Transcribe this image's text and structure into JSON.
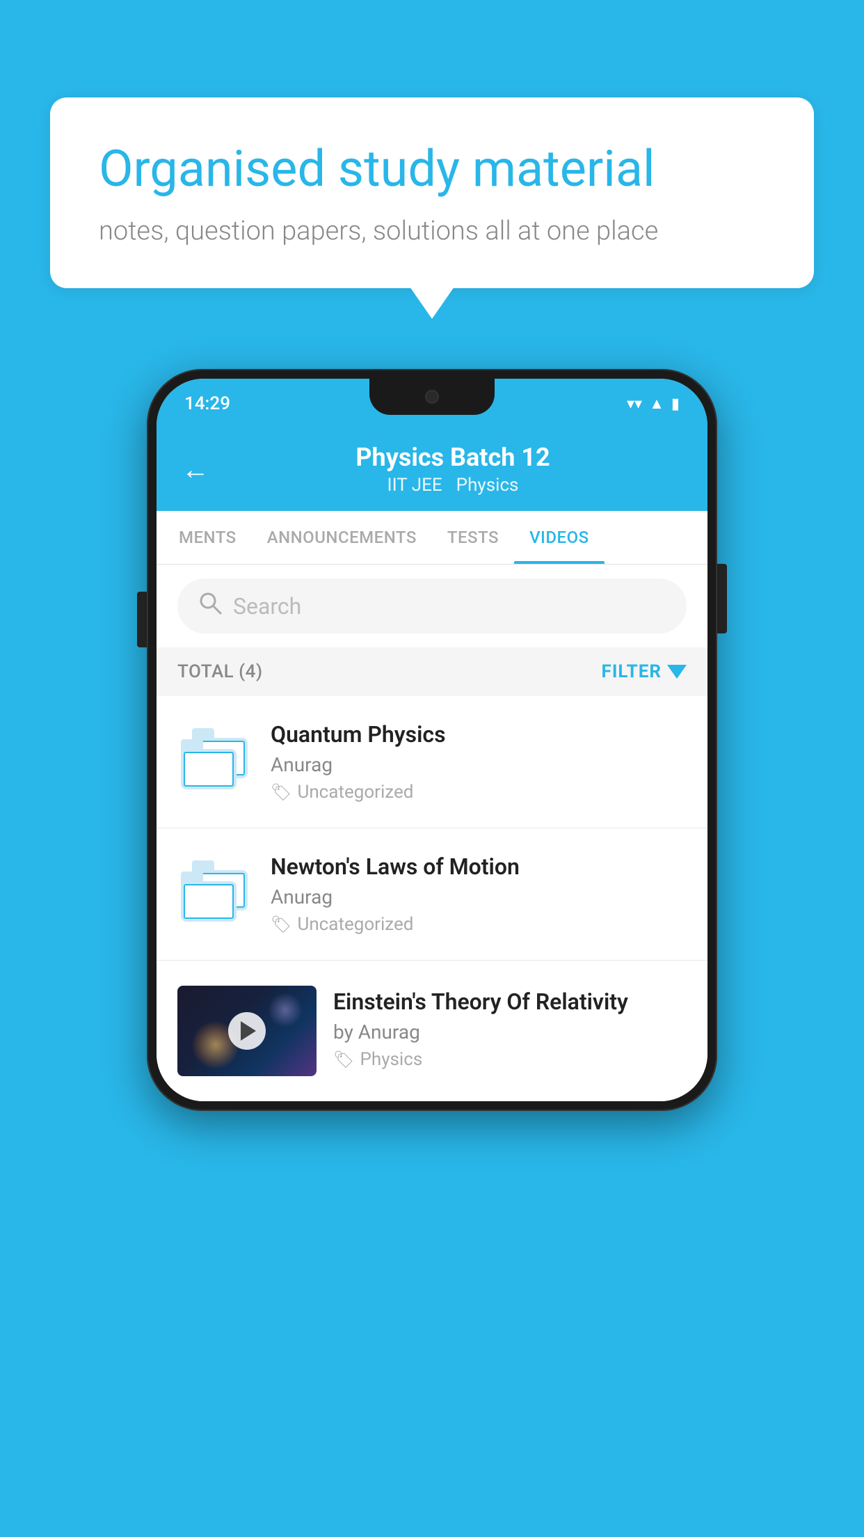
{
  "background_color": "#29b6e8",
  "speech_bubble": {
    "title": "Organised study material",
    "subtitle": "notes, question papers, solutions all at one place"
  },
  "phone": {
    "status_bar": {
      "time": "14:29",
      "icons": [
        "wifi",
        "signal",
        "battery"
      ]
    },
    "header": {
      "title": "Physics Batch 12",
      "tag1": "IIT JEE",
      "tag2": "Physics",
      "back_label": "←"
    },
    "tabs": [
      {
        "label": "MENTS",
        "active": false
      },
      {
        "label": "ANNOUNCEMENTS",
        "active": false
      },
      {
        "label": "TESTS",
        "active": false
      },
      {
        "label": "VIDEOS",
        "active": true
      }
    ],
    "search": {
      "placeholder": "Search"
    },
    "filter": {
      "total_label": "TOTAL (4)",
      "filter_label": "FILTER"
    },
    "videos": [
      {
        "title": "Quantum Physics",
        "author": "Anurag",
        "tag": "Uncategorized",
        "has_thumbnail": false
      },
      {
        "title": "Newton's Laws of Motion",
        "author": "Anurag",
        "tag": "Uncategorized",
        "has_thumbnail": false
      },
      {
        "title": "Einstein's Theory Of Relativity",
        "author": "by Anurag",
        "tag": "Physics",
        "has_thumbnail": true
      }
    ]
  }
}
